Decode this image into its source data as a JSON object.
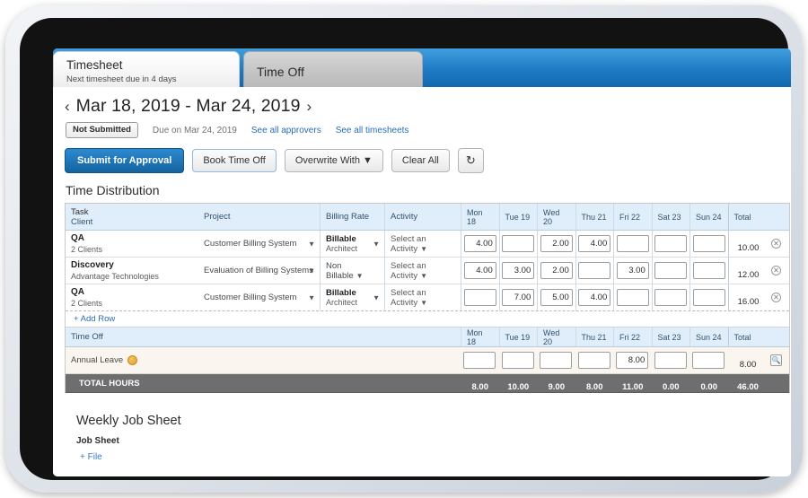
{
  "tabs": [
    {
      "label": "Timesheet",
      "sub": "Next timesheet due in 4 days"
    },
    {
      "label": "Time Off",
      "sub": ""
    }
  ],
  "date_nav": {
    "prev_icon": "chevron-left-icon",
    "range": "Mar 18, 2019 - Mar 24, 2019",
    "next_icon": "chevron-right-icon"
  },
  "status": {
    "badge": "Not Submitted",
    "due": "Due on Mar 24, 2019",
    "link_approvers": "See all approvers",
    "link_timesheets": "See all timesheets"
  },
  "toolbar": {
    "submit": "Submit for Approval",
    "book_time_off": "Book Time Off",
    "overwrite_with": "Overwrite With",
    "clear_all": "Clear All",
    "refresh_icon": "↻"
  },
  "section_title": "Time Distribution",
  "table": {
    "headers": {
      "task": "Task",
      "client": "Client",
      "project": "Project",
      "billing_rate": "Billing Rate",
      "activity": "Activity",
      "total": "Total"
    },
    "days": [
      "Mon 18",
      "Tue 19",
      "Wed 20",
      "Thu 21",
      "Fri 22",
      "Sat 23",
      "Sun 24"
    ],
    "rows": [
      {
        "task": "QA",
        "client": "2 Clients",
        "project": "Customer Billing System",
        "rate": "Billable",
        "rate_sub": "Architect",
        "rate_bold": true,
        "activity": "Select an Activity",
        "hours": [
          "4.00",
          "",
          "2.00",
          "4.00",
          "",
          "",
          ""
        ],
        "total": "10.00"
      },
      {
        "task": "Discovery",
        "client": "Advantage Technologies",
        "project": "Evaluation of Billing Systems",
        "rate": "Non Billable",
        "rate_sub": "",
        "rate_bold": false,
        "activity": "Select an Activity",
        "hours": [
          "4.00",
          "3.00",
          "2.00",
          "",
          "3.00",
          "",
          ""
        ],
        "total": "12.00"
      },
      {
        "task": "QA",
        "client": "2 Clients",
        "project": "Customer Billing System",
        "rate": "Billable",
        "rate_sub": "Architect",
        "rate_bold": true,
        "activity": "Select an Activity",
        "hours": [
          "",
          "7.00",
          "5.00",
          "4.00",
          "",
          "",
          ""
        ],
        "total": "16.00"
      }
    ],
    "add_row": "+ Add Row",
    "time_off_section": {
      "label": "Time Off",
      "leave_name": "Annual Leave",
      "hours": [
        "",
        "",
        "",
        "",
        "8.00",
        "",
        ""
      ],
      "total": "8.00"
    },
    "totals": {
      "label": "TOTAL HOURS",
      "days": [
        "8.00",
        "10.00",
        "9.00",
        "8.00",
        "11.00",
        "0.00",
        "0.00"
      ],
      "grand_total": "46.00"
    }
  },
  "bottom": {
    "title": "Weekly Job Sheet",
    "subtitle": "Job Sheet",
    "add_file": "+ File"
  }
}
